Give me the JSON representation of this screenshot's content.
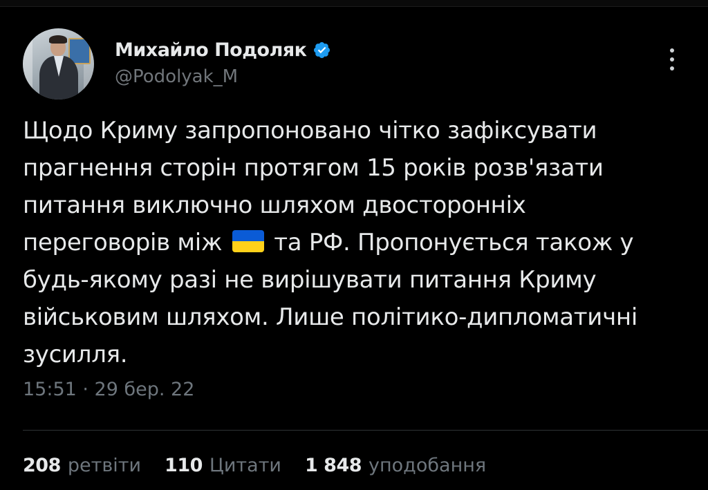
{
  "author": {
    "display_name": "Михайло Подоляк",
    "handle": "@Podolyak_M",
    "verified": true
  },
  "tweet": {
    "text_before_flag": "Щодо Криму запропоновано чітко зафіксувати прагнення сторін протягом 15 років розв'язати питання виключно шляхом двосторонніх переговорів між",
    "flag_emoji": "🇺🇦",
    "text_after_flag": "та РФ. Пропонується також у будь-якому разі не вирішувати питання Криму військовим шляхом. Лише політико-дипломатичні зусилля.",
    "timestamp": "15:51 · 29 бер. 22"
  },
  "stats": {
    "retweets_count": "208",
    "retweets_label": "ретвіти",
    "quotes_count": "110",
    "quotes_label": "Цитати",
    "likes_count": "1 848",
    "likes_label": "уподобання"
  },
  "colors": {
    "background": "#000000",
    "text_primary": "#e7e9ea",
    "text_secondary": "#71767b",
    "verified_badge": "#1d9bf0",
    "flag_blue": "#0a5bd6",
    "flag_yellow": "#ffd11a"
  },
  "icons": {
    "verified": "verified-badge-icon",
    "more": "more-vertical-icon"
  }
}
